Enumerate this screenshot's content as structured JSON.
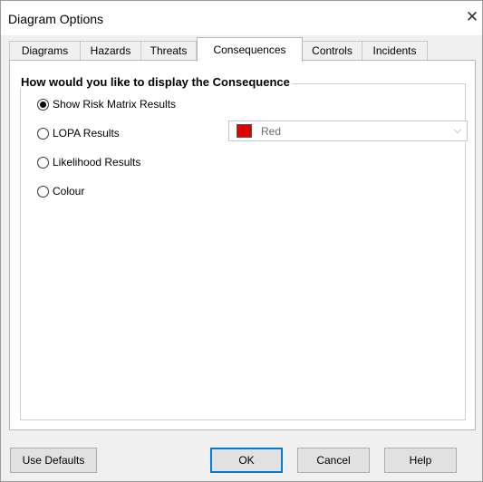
{
  "window": {
    "title": "Diagram Options",
    "close_glyph": "✕"
  },
  "tabs": [
    {
      "label": "Diagrams",
      "active": false
    },
    {
      "label": "Hazards",
      "active": false
    },
    {
      "label": "Threats",
      "active": false
    },
    {
      "label": "Consequences",
      "active": true
    },
    {
      "label": "Controls",
      "active": false
    },
    {
      "label": "Incidents",
      "active": false
    }
  ],
  "group": {
    "title": "How would you like to display the Consequence",
    "options": [
      {
        "label": "Show Risk Matrix Results",
        "checked": true
      },
      {
        "label": "LOPA Results",
        "checked": false
      },
      {
        "label": "Likelihood Results",
        "checked": false
      },
      {
        "label": "Colour",
        "checked": false
      }
    ]
  },
  "colour_select": {
    "value": "Red",
    "swatch_color": "#e00000",
    "arrow_glyph": "⌵"
  },
  "buttons": {
    "use_defaults": "Use Defaults",
    "ok": "OK",
    "cancel": "Cancel",
    "help": "Help"
  }
}
